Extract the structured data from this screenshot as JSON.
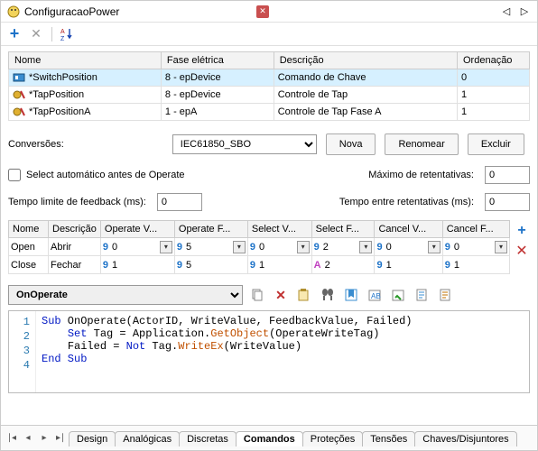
{
  "window": {
    "title": "ConfiguracaoPower"
  },
  "table1": {
    "headers": {
      "nome": "Nome",
      "fase": "Fase elétrica",
      "desc": "Descrição",
      "ord": "Ordenação"
    },
    "rows": [
      {
        "nome": "*SwitchPosition",
        "fase": "8 - epDevice",
        "desc": "Comando de Chave",
        "ord": "0"
      },
      {
        "nome": "*TapPosition",
        "fase": "8 - epDevice",
        "desc": "Controle de Tap",
        "ord": "1"
      },
      {
        "nome": "*TapPositionA",
        "fase": "1 - epA",
        "desc": "Controle de Tap Fase A",
        "ord": "1"
      }
    ]
  },
  "labels": {
    "conversoes": "Conversões:",
    "selectAuto": "Select automático antes de Operate",
    "maxRetent": "Máximo de retentativas:",
    "tempoFeedback": "Tempo limite de feedback (ms):",
    "tempoRetent": "Tempo entre retentativas (ms):"
  },
  "convCombo": "IEC61850_SBO",
  "buttons": {
    "nova": "Nova",
    "renomear": "Renomear",
    "excluir": "Excluir"
  },
  "inputs": {
    "maxRetent": "0",
    "tempoFeedback": "0",
    "tempoRetent": "0"
  },
  "table2": {
    "headers": {
      "nome": "Nome",
      "desc": "Descrição",
      "opV": "Operate V...",
      "opF": "Operate F...",
      "selV": "Select V...",
      "selF": "Select F...",
      "canV": "Cancel V...",
      "canF": "Cancel F..."
    },
    "rows": [
      {
        "nome": "Open",
        "desc": "Abrir",
        "opV": {
          "p": "9",
          "v": "0"
        },
        "opF": {
          "p": "9",
          "v": "5"
        },
        "selV": {
          "p": "9",
          "v": "0"
        },
        "selF": {
          "p": "9",
          "v": "2"
        },
        "canV": {
          "p": "9",
          "v": "0"
        },
        "canF": {
          "p": "9",
          "v": "0"
        }
      },
      {
        "nome": "Close",
        "desc": "Fechar",
        "opV": {
          "p": "9",
          "v": "1"
        },
        "opF": {
          "p": "9",
          "v": "5"
        },
        "selV": {
          "p": "9",
          "v": "1"
        },
        "selF": {
          "p": "A",
          "v": "2"
        },
        "canV": {
          "p": "9",
          "v": "1"
        },
        "canF": {
          "p": "9",
          "v": "1"
        }
      }
    ]
  },
  "editor": {
    "combo": "OnOperate",
    "lines": [
      "1",
      "2",
      "3",
      "4"
    ],
    "code": {
      "l1a": "Sub",
      "l1b": " OnOperate(ActorID, WriteValue, FeedbackValue, Failed)",
      "l2a": "Set",
      "l2b": " Tag = Application.",
      "l2c": "GetObject",
      "l2d": "(OperateWriteTag)",
      "l3a": "Failed = ",
      "l3b": "Not",
      "l3c": " Tag.",
      "l3d": "WriteEx",
      "l3e": "(WriteValue)",
      "l4a": "End Sub"
    }
  },
  "tabs": [
    "Design",
    "Analógicas",
    "Discretas",
    "Comandos",
    "Proteções",
    "Tensões",
    "Chaves/Disjuntores"
  ],
  "activeTab": "Comandos"
}
